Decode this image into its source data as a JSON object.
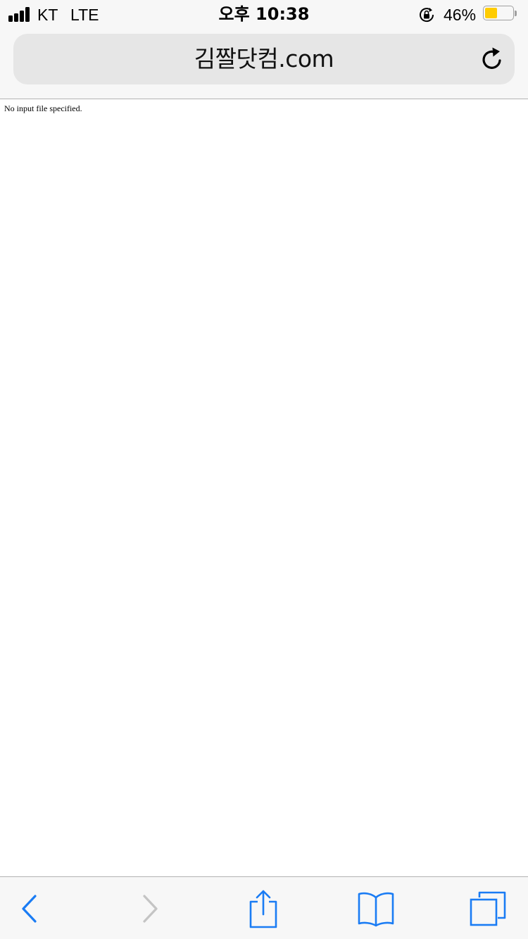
{
  "status_bar": {
    "carrier": "KT",
    "network": "LTE",
    "time": "오후 10:38",
    "battery_percent": "46%",
    "battery_level": 0.46,
    "battery_color": "#ffcc00",
    "signal_bars": 4,
    "icons": [
      "signal-icon",
      "rotation-lock-icon",
      "battery-icon"
    ]
  },
  "address_bar": {
    "url": "김짤닷컴.com",
    "reload_icon": "reload-icon"
  },
  "page": {
    "message": "No input file specified."
  },
  "toolbar": {
    "accent_color": "#1a7cf4",
    "disabled_color": "#c4c4c4",
    "items": [
      {
        "icon": "back-icon",
        "enabled": true
      },
      {
        "icon": "forward-icon",
        "enabled": false
      },
      {
        "icon": "share-icon",
        "enabled": true
      },
      {
        "icon": "bookmarks-icon",
        "enabled": true
      },
      {
        "icon": "tabs-icon",
        "enabled": true
      }
    ]
  }
}
